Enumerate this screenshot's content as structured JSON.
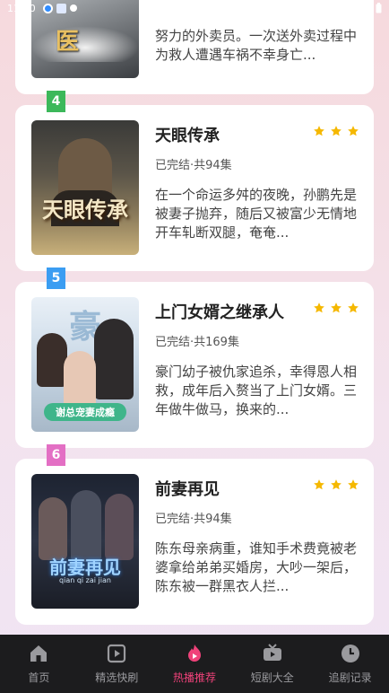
{
  "status": {
    "time": "11:50"
  },
  "cards": [
    {
      "rank": "",
      "title": "",
      "meta": "",
      "description": "努力的外卖员。一次送外卖过程中为救人遭遇车祸不幸身亡...",
      "poster_text": "医"
    },
    {
      "rank": "4",
      "badge_color": "#3cb85a",
      "title": "天眼传承",
      "meta": "已完结·共94集",
      "description": "在一个命运多舛的夜晚，孙鹏先是被妻子抛弃，随后又被富少无情地开车轧断双腿，奄奄...",
      "poster_text": "天眼传承"
    },
    {
      "rank": "5",
      "badge_color": "#3b9df2",
      "title": "上门女婿之继承人",
      "meta": "已完结·共169集",
      "description": "豪门幼子被仇家追杀，幸得恩人相救，成年后入赘当了上门女婿。三年做牛做马，换来的...",
      "poster_text": "豪",
      "poster_caption": "谢总宠妻成瘾"
    },
    {
      "rank": "6",
      "badge_color": "#e36fc4",
      "title": "前妻再见",
      "meta": "已完结·共94集",
      "description": "陈东母亲病重，谁知手术费竟被老婆拿给弟弟买婚房，大吵一架后，陈东被一群黑衣人拦...",
      "poster_text": "前妻再见",
      "poster_caption": "qian qi zai jian"
    }
  ],
  "colors": {
    "star": "#f5b800",
    "accent": "#f0427a",
    "nav_bg": "#1c1c1e"
  },
  "nav": [
    {
      "label": "首页",
      "icon": "home-icon"
    },
    {
      "label": "精选快刷",
      "icon": "play-square-icon"
    },
    {
      "label": "热播推荐",
      "icon": "flame-icon",
      "active": true
    },
    {
      "label": "短剧大全",
      "icon": "tv-icon"
    },
    {
      "label": "追剧记录",
      "icon": "clock-icon"
    }
  ]
}
